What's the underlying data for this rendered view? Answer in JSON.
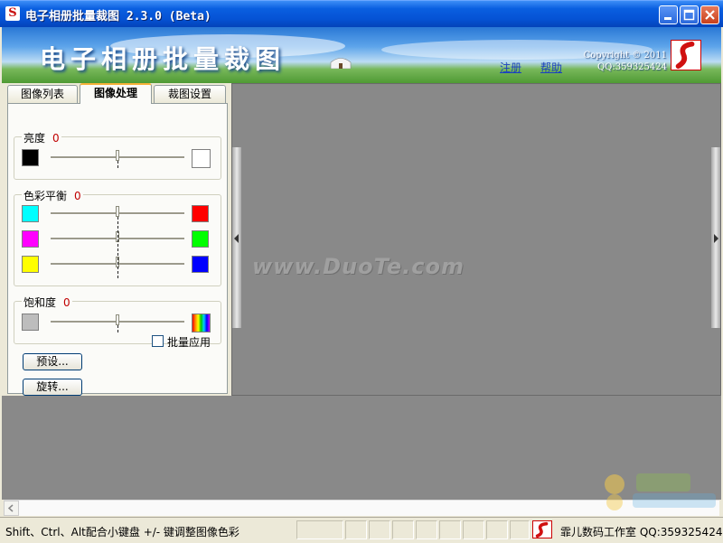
{
  "window": {
    "title": "电子相册批量裁图  2.3.0  (Beta)",
    "icon_glyph": "S"
  },
  "banner": {
    "title": "电子相册批量裁图",
    "register_link": "注册",
    "help_link": "帮助",
    "copyright_line1": "Copyright © 2011",
    "copyright_line2": "QQ:359325424"
  },
  "tabs": [
    {
      "label": "图像列表",
      "selected": false
    },
    {
      "label": "图像处理",
      "selected": true
    },
    {
      "label": "裁图设置",
      "selected": false
    }
  ],
  "groups": {
    "brightness": {
      "label": "亮度",
      "value": "0",
      "sliders": [
        {
          "left_color": "#000000",
          "right_color": "#ffffff",
          "level": 0.5
        }
      ]
    },
    "color_balance": {
      "label": "色彩平衡",
      "value": "0",
      "sliders": [
        {
          "left_color": "#00ffff",
          "right_color": "#ff0000",
          "level": 0.5
        },
        {
          "left_color": "#ff00ff",
          "right_color": "#00ff00",
          "level": 0.5
        },
        {
          "left_color": "#ffff00",
          "right_color": "#0000ff",
          "level": 0.5
        }
      ]
    },
    "saturation": {
      "label": "饱和度",
      "value": "0",
      "sliders": [
        {
          "left_color": "#bdbdbd",
          "right_color": "rainbow",
          "level": 0.5
        }
      ]
    }
  },
  "buttons": {
    "preset": "预设...",
    "rotate": "旋转..."
  },
  "batch_apply": {
    "label": "批量应用",
    "checked": false
  },
  "preview": {
    "watermark": "www.DuoTe.com"
  },
  "status": {
    "hint": "Shift、Ctrl、Alt配合小键盘 +/- 键调整图像色彩",
    "studio": "霏儿数码工作室 QQ:359325424"
  },
  "colors": {
    "titlebar": "#0552d4",
    "value_red": "#c00000",
    "link_blue": "#1a3fc0",
    "preview_bg": "#898989"
  }
}
